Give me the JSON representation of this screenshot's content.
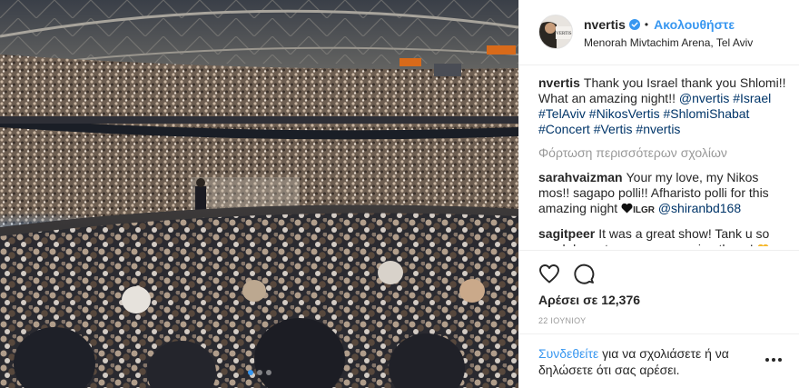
{
  "colors": {
    "accent": "#3897f0",
    "hashtag": "#003569",
    "muted": "#999999",
    "text": "#262626"
  },
  "header": {
    "username": "nvertis",
    "separator": "•",
    "follow_label": "Ακολουθήστε",
    "location": "Menorah Mivtachim Arena, Tel Aviv",
    "avatar_text": "VERTIS"
  },
  "caption": {
    "username": "nvertis",
    "text": "Thank you Israel thank you Shlomi!! What an amazing night!!",
    "tags": [
      "@nvertis",
      "#Israel",
      "#TelAviv",
      "#NikosVertis",
      "#ShlomiShabat",
      "#Concert",
      "#Vertis",
      "#nvertis"
    ]
  },
  "load_more": "Φόρτωση περισσότερων σχολίων",
  "comments": [
    {
      "username": "sarahvaizman",
      "text": "Your my love, my Nikos mos!! sagapo polli!! Afharisto polli for this amazing night",
      "suffix": "ILGR",
      "mention": "@shiranbd168"
    },
    {
      "username": "sagitpeer",
      "text": "It was a great show! Tank u so much,hope to see you soon in athens!"
    }
  ],
  "actions": {
    "like_icon": "heart-icon",
    "comment_icon": "comment-icon",
    "likes_label": "Αρέσει σε 12,376",
    "date": "22 ΙΟΥΝΙΟΥ"
  },
  "login": {
    "link": "Συνδεθείτε",
    "text": " για να σχολιάσετε ή να δηλώσετε ότι σας αρέσει."
  },
  "carousel": {
    "total": 3,
    "active_index": 0
  }
}
